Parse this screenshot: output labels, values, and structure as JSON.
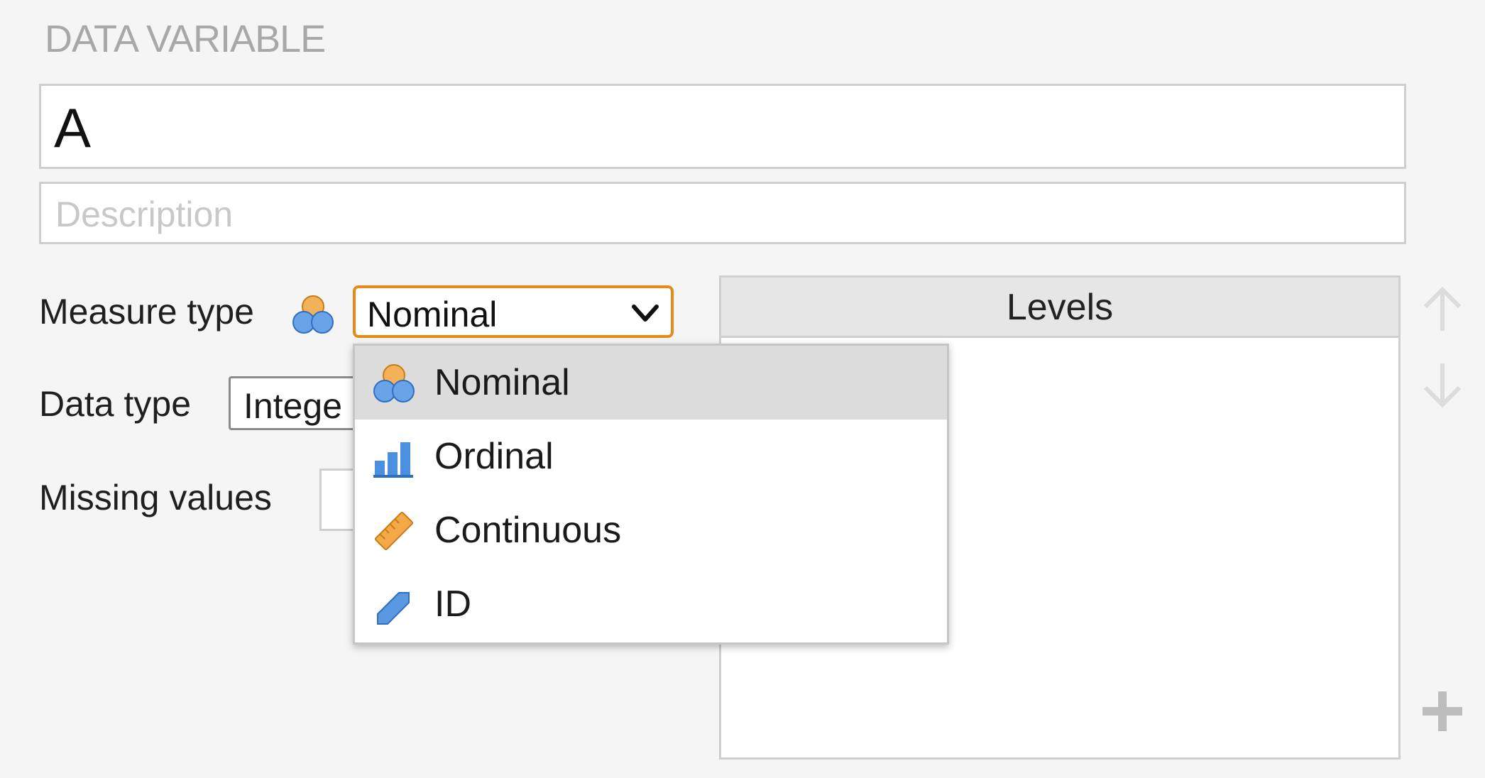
{
  "section_title": "DATA VARIABLE",
  "name_field": {
    "value": "A"
  },
  "description_field": {
    "placeholder": "Description",
    "value": ""
  },
  "measure_type": {
    "label": "Measure type",
    "icon": "nominal-icon",
    "selected": "Nominal",
    "accent_color": "#e88a1a"
  },
  "data_type": {
    "label": "Data type",
    "selected": "Intege"
  },
  "missing_values": {
    "label": "Missing values"
  },
  "levels": {
    "header": "Levels"
  },
  "dropdown": {
    "items": [
      {
        "label": "Nominal",
        "icon": "nominal-icon",
        "selected": true
      },
      {
        "label": "Ordinal",
        "icon": "ordinal-icon",
        "selected": false
      },
      {
        "label": "Continuous",
        "icon": "continuous-icon",
        "selected": false
      },
      {
        "label": "ID",
        "icon": "id-icon",
        "selected": false
      }
    ]
  }
}
